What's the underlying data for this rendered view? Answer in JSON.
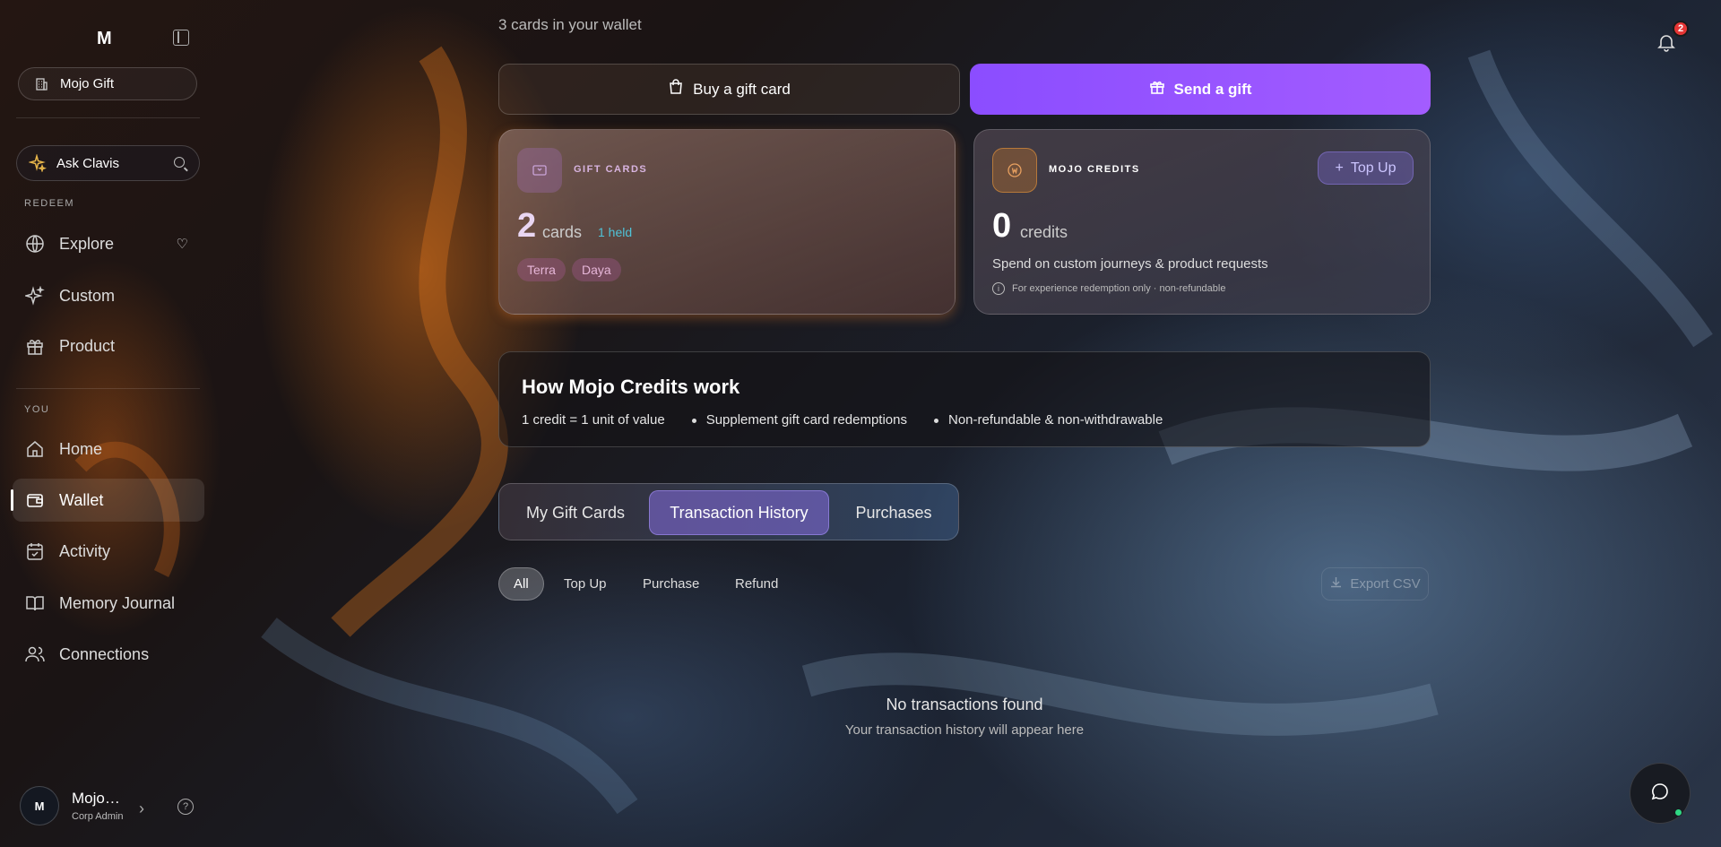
{
  "sidebar": {
    "logo": "M",
    "org_name": "Mojo Gift",
    "ask_label": "Ask Clavis",
    "section_redeem": "REDEEM",
    "section_you": "YOU",
    "redeem_items": [
      {
        "label": "Explore",
        "icon": "globe-icon"
      },
      {
        "label": "Custom",
        "icon": "sparkle-icon"
      },
      {
        "label": "Product",
        "icon": "gift-icon"
      }
    ],
    "you_items": [
      {
        "label": "Home",
        "icon": "home-icon"
      },
      {
        "label": "Wallet",
        "icon": "wallet-icon"
      },
      {
        "label": "Activity",
        "icon": "calendar-check-icon"
      },
      {
        "label": "Memory Journal",
        "icon": "book-icon"
      },
      {
        "label": "Connections",
        "icon": "users-icon"
      }
    ],
    "active_item": "Wallet",
    "user": {
      "initial": "M",
      "name": "Mojo…",
      "role": "Corp Admin"
    }
  },
  "header": {
    "subtitle": "3 cards in your wallet",
    "notification_count": "2"
  },
  "actions": {
    "buy_label": "Buy a gift card",
    "send_label": "Send a gift"
  },
  "gift_cards": {
    "label": "GIFT CARDS",
    "count": "2",
    "unit": "cards",
    "held": "1 held",
    "tags": [
      "Terra",
      "Daya"
    ]
  },
  "credits": {
    "label": "MOJO CREDITS",
    "topup_label": "Top Up",
    "count": "0",
    "unit": "credits",
    "spend_text": "Spend on custom journeys & product requests",
    "note": "For experience redemption only · non-refundable"
  },
  "howto": {
    "title": "How Mojo Credits work",
    "points": [
      "1 credit = 1 unit of value",
      "Supplement gift card redemptions",
      "Non-refundable & non-withdrawable"
    ]
  },
  "tabs": [
    "My Gift Cards",
    "Transaction History",
    "Purchases"
  ],
  "active_tab": "Transaction History",
  "filters": [
    "All",
    "Top Up",
    "Purchase",
    "Refund"
  ],
  "active_filter": "All",
  "export_label": "Export CSV",
  "empty": {
    "title": "No transactions found",
    "subtitle": "Your transaction history will appear here"
  },
  "colors": {
    "accent": "#9353ff",
    "held": "#4fc3d8",
    "badge": "#e53535",
    "online": "#2fd884"
  }
}
